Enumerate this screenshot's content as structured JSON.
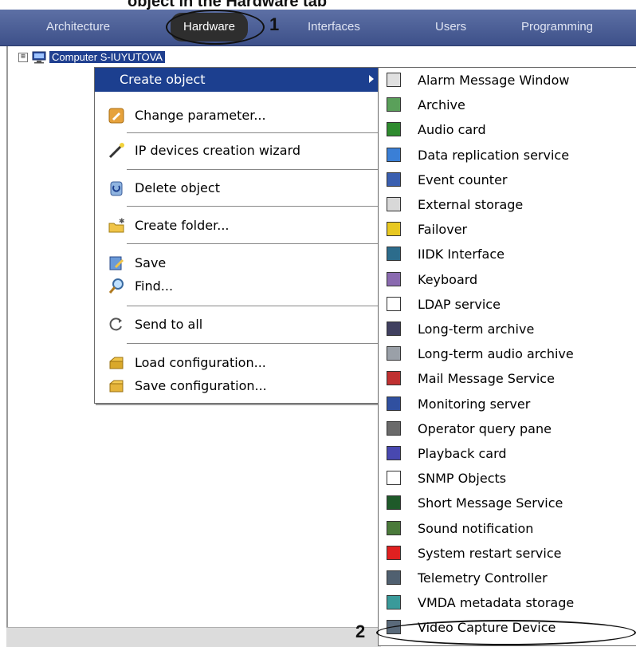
{
  "caption": "object in the Hardware tab",
  "tabs": [
    "Architecture",
    "Hardware",
    "Interfaces",
    "Users",
    "Programming"
  ],
  "markers": {
    "step1": "1",
    "step2": "2"
  },
  "tree": {
    "expander": "⊞",
    "label": "Computer S-IUYUTOVA"
  },
  "context_menu": {
    "items": [
      {
        "label": "Create object",
        "icon": "submenu-arrow"
      },
      {
        "label": "Change parameter...",
        "icon": "pencil-icon"
      },
      {
        "label": "IP devices creation wizard",
        "icon": "wand-icon"
      },
      {
        "label": "Delete object",
        "icon": "delete-icon"
      },
      {
        "label": "Create folder...",
        "icon": "folder-icon"
      },
      {
        "label": "Save",
        "icon": "save-icon"
      },
      {
        "label": "Find...",
        "icon": "magnifier-icon"
      },
      {
        "label": "Send to all",
        "icon": "refresh-icon"
      },
      {
        "label": "Load configuration...",
        "icon": "load-config-icon"
      },
      {
        "label": "Save configuration...",
        "icon": "save-config-icon"
      }
    ]
  },
  "submenu": {
    "items": [
      {
        "label": "Alarm Message Window",
        "color": "#e0e0e0"
      },
      {
        "label": "Archive",
        "color": "#5aa05a"
      },
      {
        "label": "Audio card",
        "color": "#2e8b2e"
      },
      {
        "label": "Data replication service",
        "color": "#3a7fd6"
      },
      {
        "label": "Event counter",
        "color": "#3a5fb0"
      },
      {
        "label": "External storage",
        "color": "#d8d8d8"
      },
      {
        "label": "Failover",
        "color": "#e8c820"
      },
      {
        "label": "IIDK Interface",
        "color": "#2c6c8c"
      },
      {
        "label": "Keyboard",
        "color": "#8a6ab0"
      },
      {
        "label": "LDAP service",
        "color": "#ffffff"
      },
      {
        "label": "Long-term archive",
        "color": "#404060"
      },
      {
        "label": "Long-term audio archive",
        "color": "#9aa0a8"
      },
      {
        "label": "Mail Message Service",
        "color": "#c03030"
      },
      {
        "label": "Monitoring server",
        "color": "#3050a0"
      },
      {
        "label": "Operator query pane",
        "color": "#6a6a6a"
      },
      {
        "label": "Playback card",
        "color": "#4848b0"
      },
      {
        "label": "SNMP Objects",
        "color": "#ffffff"
      },
      {
        "label": "Short Message Service",
        "color": "#1f5a2a"
      },
      {
        "label": "Sound notification",
        "color": "#4a7a3a"
      },
      {
        "label": "System restart service",
        "color": "#e02020"
      },
      {
        "label": "Telemetry Controller",
        "color": "#506070"
      },
      {
        "label": "VMDA metadata storage",
        "color": "#3a9a9a"
      },
      {
        "label": "Video Capture Device",
        "color": "#5a6a7a"
      }
    ]
  }
}
